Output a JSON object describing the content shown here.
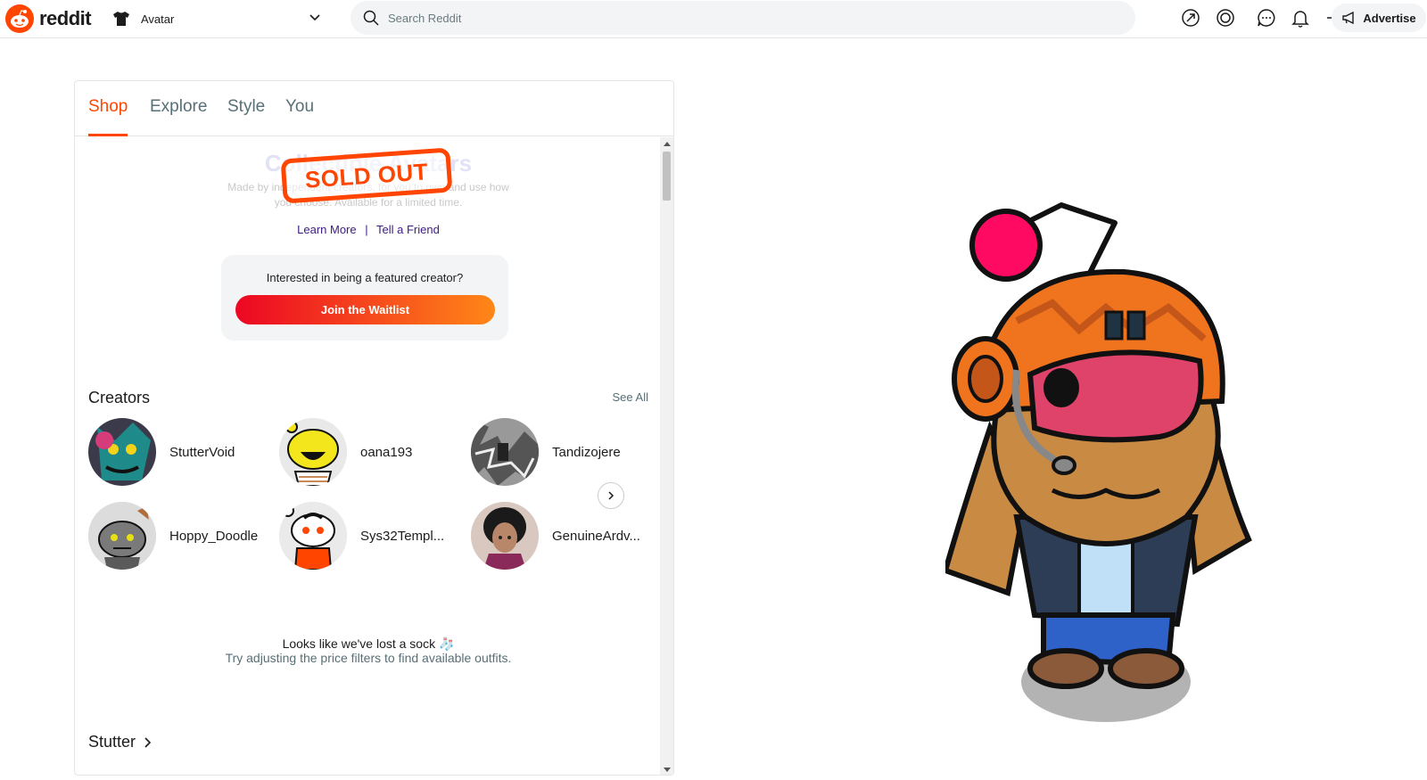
{
  "header": {
    "logo_text": "reddit",
    "community_label": "Avatar",
    "search_placeholder": "Search Reddit",
    "advertise_label": "Advertise"
  },
  "tabs": [
    {
      "label": "Shop",
      "active": true
    },
    {
      "label": "Explore",
      "active": false
    },
    {
      "label": "Style",
      "active": false
    },
    {
      "label": "You",
      "active": false
    }
  ],
  "hero": {
    "title": "Collectible Avatars",
    "description": "Made by independent creators, for you to own and use how you choose. Available for a limited time.",
    "badge": "SOLD OUT",
    "learn_more": "Learn More",
    "separator": "|",
    "tell_friend": "Tell a Friend"
  },
  "waitlist": {
    "prompt": "Interested in being a featured creator?",
    "button": "Join the Waitlist"
  },
  "creators": {
    "title": "Creators",
    "see_all": "See All",
    "items": [
      {
        "name": "StutterVoid"
      },
      {
        "name": "oana193"
      },
      {
        "name": "Tandizojere"
      },
      {
        "name": "Hoppy_Doodle"
      },
      {
        "name": "Sys32Templ..."
      },
      {
        "name": "GenuineArdv..."
      }
    ]
  },
  "empty_state": {
    "line1": "Looks like we've lost a sock 🧦",
    "line2": "Try adjusting the price filters to find available outfits."
  },
  "section": {
    "title": "Stutter"
  },
  "colors": {
    "brand": "#ff4500",
    "gradient_start": "#ec0623",
    "gradient_end": "#ff8717"
  }
}
